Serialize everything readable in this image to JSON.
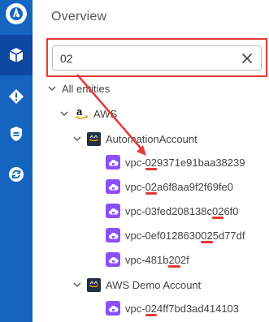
{
  "app": {
    "title": "Overview"
  },
  "search": {
    "value": "02",
    "placeholder": ""
  },
  "tree": {
    "root": "All entities",
    "provider": "AWS",
    "accounts": [
      {
        "name": "AutomationAccount",
        "vpcs": [
          {
            "pre": "vpc-",
            "match": "02",
            "post": "9371e91baa38239"
          },
          {
            "pre": "vpc-",
            "match": "02",
            "post": "a6f8aa9f2f69fe0"
          },
          {
            "pre": "vpc-03fed208138c",
            "match": "02",
            "post": "6f0"
          },
          {
            "pre": "vpc-0ef0128630",
            "match": "02",
            "post": "5d77df"
          },
          {
            "pre": "vpc-481b",
            "match": "20",
            "post": "2f",
            "alt": true
          }
        ]
      },
      {
        "name": "AWS Demo Account",
        "vpcs": [
          {
            "pre": "vpc-",
            "match": "02",
            "post": "4ff7bd3ad414103"
          }
        ]
      }
    ]
  },
  "icons": {
    "rail": [
      "app-logo-icon",
      "box-icon",
      "alert-diamond-icon",
      "shield-icon",
      "sync-icon"
    ],
    "search_clear": "close-icon",
    "tree_toggle": "chevron-down-icon",
    "provider": "amazon-icon",
    "account": "aws-icon",
    "vpc": "vpc-cloud-icon"
  },
  "colors": {
    "rail": "#1565c0",
    "rail_active": "#0d47a1",
    "highlight": "#e53935",
    "vpc": "#8c4fff",
    "aws_badge": "#232f3e"
  }
}
